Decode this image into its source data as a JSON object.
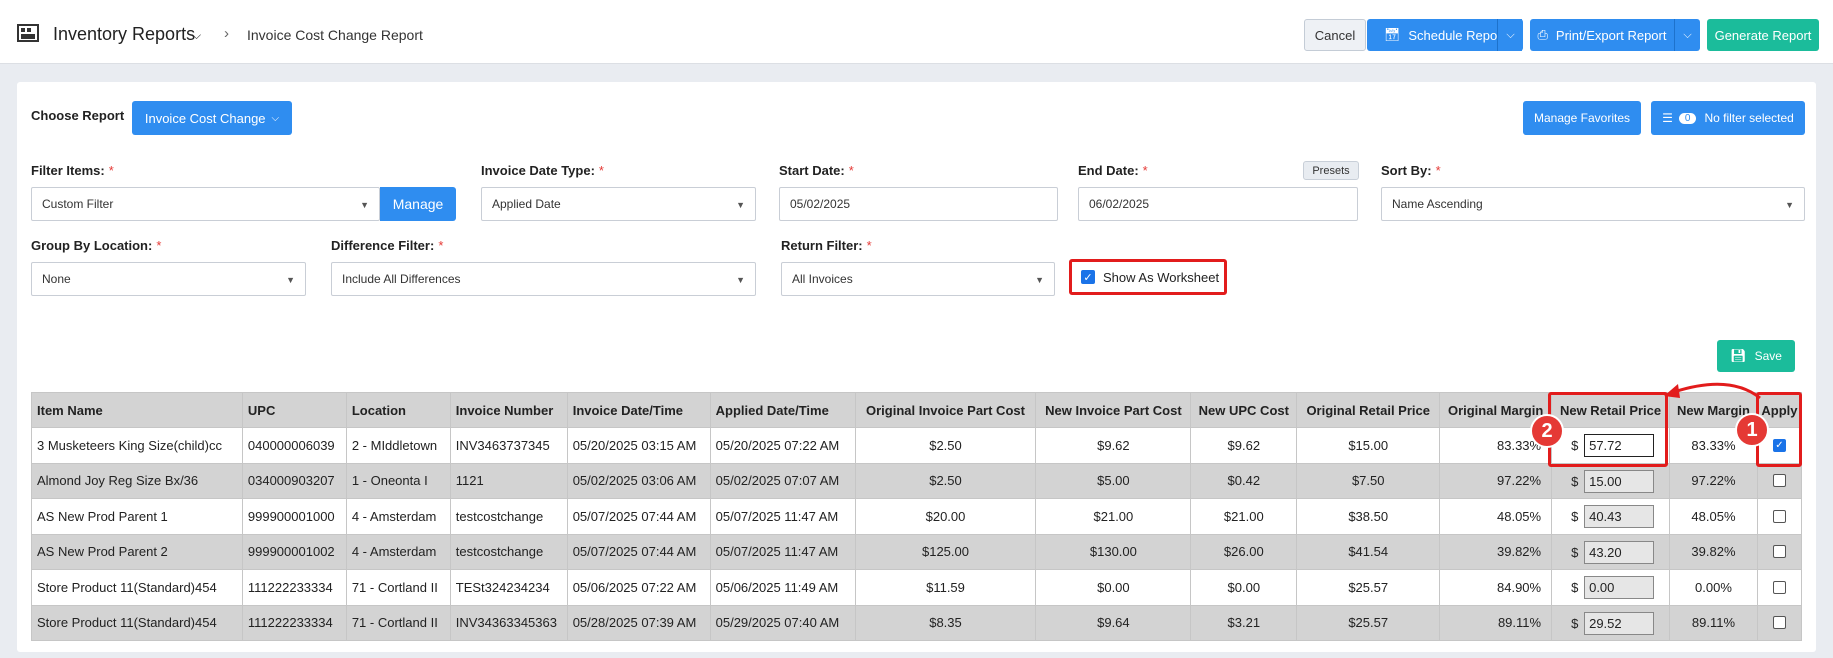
{
  "header": {
    "app_title": "Inventory Reports",
    "breadcrumb": "Invoice Cost Change Report",
    "cancel": "Cancel",
    "schedule": "Schedule Report",
    "print_export": "Print/Export Report",
    "generate": "Generate Report"
  },
  "toolbar": {
    "choose_report_label": "Choose Report",
    "choose_report_value": "Invoice Cost Change",
    "manage_favorites": "Manage Favorites",
    "filter_count": "0",
    "filter_status": "No filter selected"
  },
  "filters": {
    "filter_items_label": "Filter Items:",
    "filter_items_value": "Custom Filter",
    "manage": "Manage",
    "invoice_date_type_label": "Invoice Date Type:",
    "invoice_date_type_value": "Applied Date",
    "start_date_label": "Start Date:",
    "start_date_value": "05/02/2025",
    "end_date_label": "End Date:",
    "end_date_value": "06/02/2025",
    "presets": "Presets",
    "sort_by_label": "Sort By:",
    "sort_by_value": "Name Ascending",
    "group_by_label": "Group By Location:",
    "group_by_value": "None",
    "difference_label": "Difference Filter:",
    "difference_value": "Include All Differences",
    "return_label": "Return Filter:",
    "return_value": "All Invoices",
    "show_worksheet": "Show As Worksheet",
    "required_mark": "*"
  },
  "save": "Save",
  "table": {
    "columns": [
      "Item Name",
      "UPC",
      "Location",
      "Invoice Number",
      "Invoice Date/Time",
      "Applied Date/Time",
      "Original Invoice Part Cost",
      "New Invoice Part Cost",
      "New UPC Cost",
      "Original Retail Price",
      "Original Margin",
      "New Retail Price",
      "New Margin",
      "Apply"
    ],
    "currency_symbol": "$",
    "rows": [
      {
        "item": "3 Musketeers King Size(child)cc",
        "upc": "040000006039",
        "location": "2 - MIddletown",
        "invoice": "INV3463737345",
        "invoice_dt": "05/20/2025 03:15 AM",
        "applied_dt": "05/20/2025 07:22 AM",
        "orig_cost": "$2.50",
        "new_cost": "$9.62",
        "upc_cost": "$9.62",
        "orig_retail": "$15.00",
        "orig_margin": "83.33%",
        "new_retail": "57.72",
        "new_margin": "83.33%",
        "apply": true
      },
      {
        "item": "Almond Joy Reg Size Bx/36",
        "upc": "034000903207",
        "location": "1 - Oneonta I",
        "invoice": "1121",
        "invoice_dt": "05/02/2025 03:06 AM",
        "applied_dt": "05/02/2025 07:07 AM",
        "orig_cost": "$2.50",
        "new_cost": "$5.00",
        "upc_cost": "$0.42",
        "orig_retail": "$7.50",
        "orig_margin": "97.22%",
        "new_retail": "15.00",
        "new_margin": "97.22%",
        "apply": false
      },
      {
        "item": "AS New Prod Parent 1",
        "upc": "999900001000",
        "location": "4 - Amsterdam",
        "invoice": "testcostchange",
        "invoice_dt": "05/07/2025 07:44 AM",
        "applied_dt": "05/07/2025 11:47 AM",
        "orig_cost": "$20.00",
        "new_cost": "$21.00",
        "upc_cost": "$21.00",
        "orig_retail": "$38.50",
        "orig_margin": "48.05%",
        "new_retail": "40.43",
        "new_margin": "48.05%",
        "apply": false
      },
      {
        "item": "AS New Prod Parent 2",
        "upc": "999900001002",
        "location": "4 - Amsterdam",
        "invoice": "testcostchange",
        "invoice_dt": "05/07/2025 07:44 AM",
        "applied_dt": "05/07/2025 11:47 AM",
        "orig_cost": "$125.00",
        "new_cost": "$130.00",
        "upc_cost": "$26.00",
        "orig_retail": "$41.54",
        "orig_margin": "39.82%",
        "new_retail": "43.20",
        "new_margin": "39.82%",
        "apply": false
      },
      {
        "item": "Store Product 11(Standard)454",
        "upc": "111222233334",
        "location": "71 - Cortland II",
        "invoice": "TESt324234234",
        "invoice_dt": "05/06/2025 07:22 AM",
        "applied_dt": "05/06/2025 11:49 AM",
        "orig_cost": "$11.59",
        "new_cost": "$0.00",
        "upc_cost": "$0.00",
        "orig_retail": "$25.57",
        "orig_margin": "84.90%",
        "new_retail": "0.00",
        "new_margin": "0.00%",
        "apply": false
      },
      {
        "item": "Store Product 11(Standard)454",
        "upc": "111222233334",
        "location": "71 - Cortland II",
        "invoice": "INV34363345363",
        "invoice_dt": "05/28/2025 07:39 AM",
        "applied_dt": "05/29/2025 07:40 AM",
        "orig_cost": "$8.35",
        "new_cost": "$9.64",
        "upc_cost": "$3.21",
        "orig_retail": "$25.57",
        "orig_margin": "89.11%",
        "new_retail": "29.52",
        "new_margin": "89.11%",
        "apply": false
      }
    ]
  },
  "annotations": [
    "1",
    "2"
  ],
  "colors": {
    "primary": "#2f8df0",
    "teal": "#1bbc9b",
    "highlight": "#e21c1c"
  }
}
